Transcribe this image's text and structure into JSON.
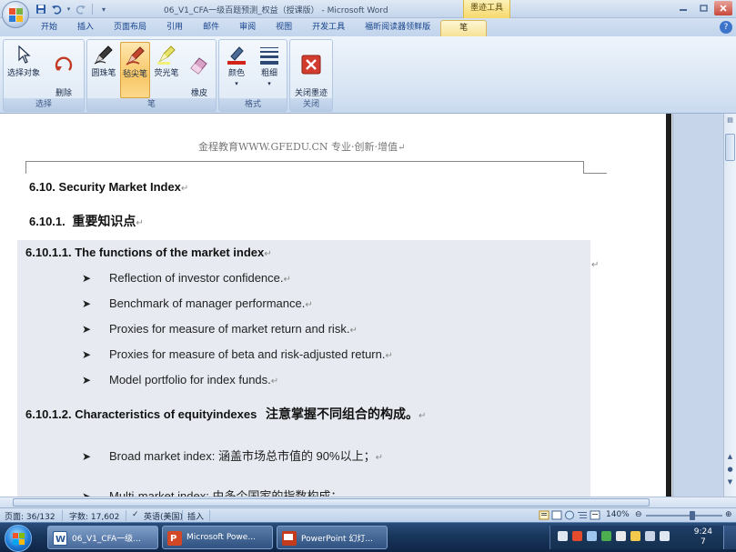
{
  "window": {
    "title": "06_V1_CFA一级百题预测_权益（授课版） - Microsoft Word",
    "context_tab_title": "墨迹工具"
  },
  "tabs": [
    "开始",
    "插入",
    "页面布局",
    "引用",
    "邮件",
    "审阅",
    "视图",
    "开发工具",
    "福昕阅读器领鲜版",
    "笔"
  ],
  "active_tab": "笔",
  "ribbon": {
    "groups": [
      {
        "label": "选择",
        "buttons": [
          "选择对象",
          "删除\n所有墨迹"
        ]
      },
      {
        "label": "笔",
        "buttons": [
          "圆珠笔",
          "毡尖笔",
          "荧光笔",
          "橡皮\n擦"
        ]
      },
      {
        "label": "格式",
        "buttons": [
          "颜色",
          "粗细"
        ]
      },
      {
        "label": "关闭",
        "buttons": [
          "关闭墨迹\n书写工具"
        ]
      }
    ],
    "selected_button": "毡尖笔"
  },
  "document": {
    "header": "金程教育WWW.GFEDU.CN 专业·创新·增值",
    "h1": "6.10.  Security Market Index",
    "h2_num": "6.10.1.",
    "h2_text": "重要知识点",
    "h3a": "6.10.1.1.  The functions of the market index",
    "bullets_a": [
      "Reflection of investor confidence.",
      "Benchmark of manager performance.",
      "Proxies for measure of market return and risk.",
      "Proxies for measure of beta and risk-adjusted return.",
      "Model portfolio for index funds."
    ],
    "h3b_en": "6.10.1.2.  Characteristics of equityindexes",
    "h3b_cn": "注意掌握不同组合的构成。",
    "bullets_b": [
      "Broad market index: 涵盖市场总市值的 90%以上；",
      "Multi-market index: 由多个国家的指数构成；"
    ],
    "para_mark": "↵"
  },
  "statusbar": {
    "page": "页面: 36/132",
    "words": "字数: 17,602",
    "language": "英语(美国)",
    "mode": "插入",
    "zoom": "140%"
  },
  "taskbar": {
    "tasks": [
      "06_V1_CFA一级...",
      "Microsoft Powe...",
      "PowerPoint 幻灯..."
    ],
    "time": "9:24",
    "date": "7"
  }
}
